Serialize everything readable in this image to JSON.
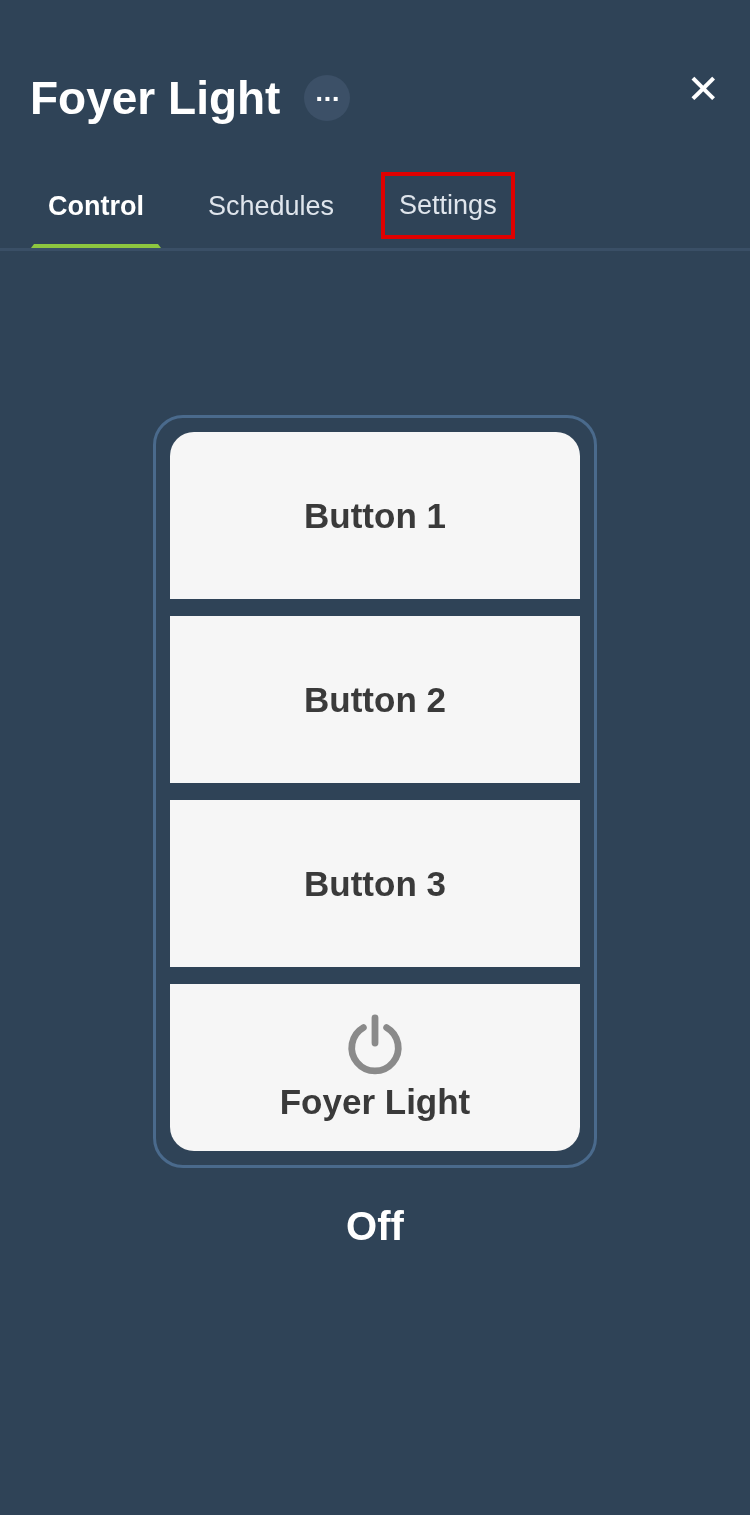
{
  "header": {
    "title": "Foyer Light",
    "more_label": "···",
    "close_label": "✕"
  },
  "tabs": [
    {
      "label": "Control",
      "selected": true,
      "highlighted": false
    },
    {
      "label": "Schedules",
      "selected": false,
      "highlighted": false
    },
    {
      "label": "Settings",
      "selected": false,
      "highlighted": true
    }
  ],
  "keypad": {
    "buttons": [
      {
        "kind": "text",
        "label": "Button 1"
      },
      {
        "kind": "text",
        "label": "Button 2"
      },
      {
        "kind": "text",
        "label": "Button 3"
      },
      {
        "kind": "power",
        "label": "Foyer Light"
      }
    ]
  },
  "status": "Off"
}
